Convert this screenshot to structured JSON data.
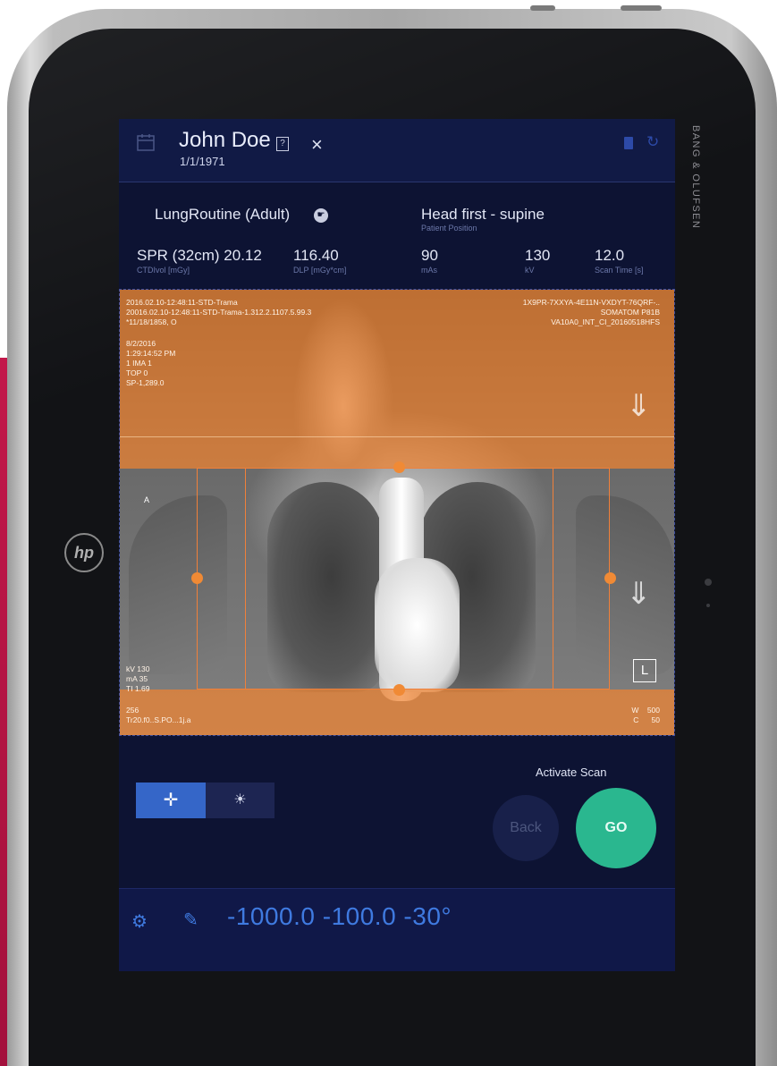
{
  "brand": "BANG & OLUFSEN",
  "header": {
    "patient_name": "John Doe",
    "help_glyph": "?",
    "close_glyph": "×",
    "dob": "1/1/1971",
    "icons": [
      "calendar-icon",
      "help-icon",
      "close-icon",
      "bookmark-icon",
      "refresh-icon"
    ]
  },
  "protocol": {
    "name": "LungRoutine (Adult)",
    "position_value": "Head first - supine",
    "position_label": "Patient Position"
  },
  "parameters": [
    {
      "value": "SPR (32cm) 20.12",
      "label": "CTDIvol [mGy]"
    },
    {
      "value": "116.40",
      "label": "DLP [mGy*cm]"
    },
    {
      "value": "90",
      "label": "mAs"
    },
    {
      "value": "130",
      "label": "kV"
    },
    {
      "value": "12.0",
      "label": "Scan Time [s]"
    }
  ],
  "viewer": {
    "top_left_1": "2016.02.10-12:48:11-STD-Trama",
    "top_left_2": "20016.02.10-12:48:11-STD-Trama-1.312.2.1107.5.99.3",
    "top_left_3": "*11/18/1858, O",
    "date_line_1": "8/2/2016",
    "date_line_2": "1:29:14:52 PM",
    "date_line_3": "1 IMA 1",
    "date_line_4": "TOP 0",
    "date_line_5": "SP-1,289.0",
    "top_right_1": "1X9PR-7XXYA-4E11N-VXDYT-76QRF-..",
    "top_right_2": "SOMATOM P81B",
    "top_right_3": "VA10A0_INT_CI_20160518HFS",
    "orientation_a": "A",
    "acq_1": "kV 130",
    "acq_2": "mA 35",
    "acq_3": "TI 1.69",
    "bottom_left_1": "256",
    "bottom_left_2": "Tr20.f0..S.PO...1j.a",
    "bottom_right_1": "W    500",
    "bottom_right_2": "C      50",
    "side_marker": "L"
  },
  "controls": {
    "activate_label": "Activate Scan",
    "back_label": "Back",
    "go_label": "GO",
    "move_glyph": "✛",
    "brightness_glyph": "☀"
  },
  "bottom_bar": {
    "gear_glyph": "⚙",
    "laser_glyph": "✎",
    "coordinates": "-1000.0 -100.0 -30°"
  },
  "colors": {
    "accent_blue": "#3f7ae0",
    "go_green": "#2ab78f",
    "overlay_orange": "#f18331",
    "screen_bg": "#0d1333"
  }
}
